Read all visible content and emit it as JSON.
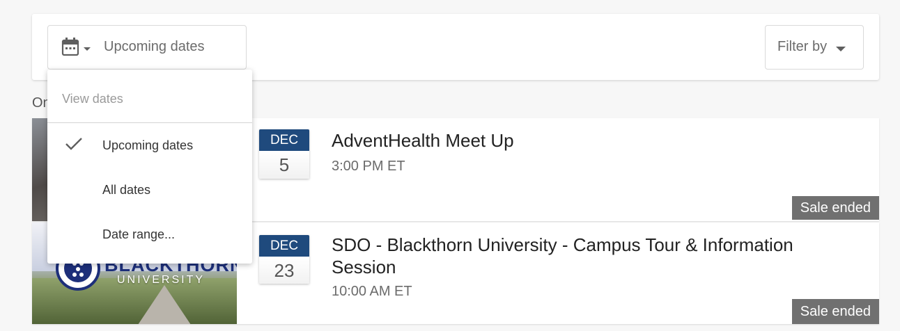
{
  "toolbar": {
    "date_select": {
      "icon": "calendar-icon",
      "label": "Upcoming dates"
    },
    "filter": {
      "label": "Filter by",
      "icon": "chevron-down-icon"
    }
  },
  "partial_text": "On",
  "dropdown": {
    "header": "View dates",
    "items": [
      {
        "label": "Upcoming dates",
        "selected": true
      },
      {
        "label": "All dates",
        "selected": false
      },
      {
        "label": "Date range...",
        "selected": false
      }
    ]
  },
  "events": [
    {
      "month": "DEC",
      "day": "5",
      "title": "AdventHealth Meet Up",
      "time": "3:00 PM ET",
      "status": "Sale ended"
    },
    {
      "month": "DEC",
      "day": "23",
      "title": "SDO - Blackthorn University - Campus Tour & Information Session",
      "time": "10:00 AM ET",
      "status": "Sale ended",
      "image_logo_text": "BLACKTHORN",
      "image_logo_sub": "UNIVERSITY"
    }
  ],
  "colors": {
    "date_badge_month_bg": "#1f4a7d",
    "sale_badge_bg": "#707070",
    "page_bg": "#f7f7f7"
  }
}
